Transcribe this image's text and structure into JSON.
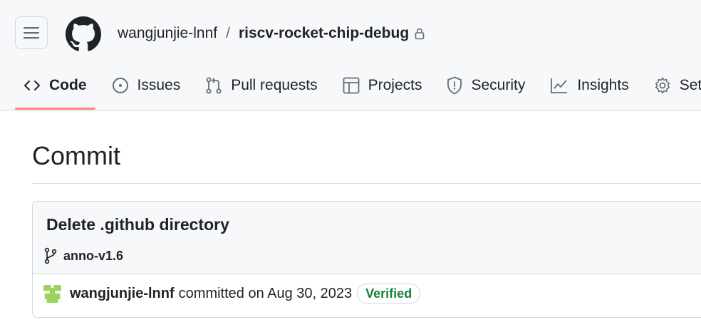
{
  "header": {
    "owner": "wangjunjie-lnnf",
    "separator": "/",
    "repo": "riscv-rocket-chip-debug"
  },
  "tabs": [
    {
      "label": "Code",
      "icon": "code-icon",
      "active": true
    },
    {
      "label": "Issues",
      "icon": "issue-icon"
    },
    {
      "label": "Pull requests",
      "icon": "pull-request-icon"
    },
    {
      "label": "Projects",
      "icon": "table-icon"
    },
    {
      "label": "Security",
      "icon": "shield-icon"
    },
    {
      "label": "Insights",
      "icon": "graph-icon"
    },
    {
      "label": "Settings",
      "icon": "gear-icon"
    }
  ],
  "page": {
    "title": "Commit"
  },
  "commit": {
    "message": "Delete .github directory",
    "branch": "anno-v1.6",
    "author": "wangjunjie-lnnf",
    "action_text": "committed on Aug 30, 2023",
    "badge": "Verified"
  },
  "colors": {
    "accent_underline": "#fd8c73",
    "verified_green": "#1a7f37",
    "avatar_green": "#9bd15c"
  }
}
